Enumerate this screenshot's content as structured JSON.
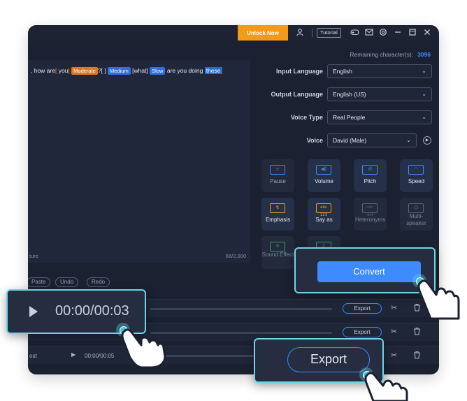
{
  "titlebar": {
    "unlock_label": "Unlock Now",
    "tutorial_label": "Tutorial",
    "icons": [
      "user-icon",
      "gamepad-icon",
      "mail-icon",
      "settings-icon",
      "minimize-icon",
      "maximize-icon",
      "close-icon"
    ]
  },
  "editor": {
    "text_before": ", how are",
    "bracket_open": "[",
    "word_you": " you",
    "bracket_close": "]",
    "tag_moderate": "Moderate",
    "text_q": "?[ ]",
    "tag_medium": "Medium",
    "text_what": "[what]",
    "tag_slow": "Slow",
    "text_doing": "are you doing",
    "highlight": "these",
    "footer_left": "ture",
    "char_count": "66/2,000"
  },
  "edit_buttons": {
    "paste": "Paste",
    "undo": "Undo",
    "redo": "Redo"
  },
  "right_panel": {
    "remaining_label": "Remaining character(s):",
    "remaining_value": "3096",
    "input_language_label": "Input Language",
    "input_language_value": "English",
    "output_language_label": "Output Language",
    "output_language_value": "English (US)",
    "voice_type_label": "Voice Type",
    "voice_type_value": "Real People",
    "voice_label": "Voice",
    "voice_value": "David (Male)"
  },
  "tools": [
    {
      "label": "Pause",
      "icon": "pause-icon"
    },
    {
      "label": "Volume",
      "icon": "volume-icon"
    },
    {
      "label": "Pitch",
      "icon": "pitch-icon"
    },
    {
      "label": "Speed",
      "icon": "speed-icon"
    },
    {
      "label": "Emphasis",
      "icon": "emphasis-icon"
    },
    {
      "label": "Say as",
      "icon": "say-as-icon",
      "icon_text": "abc 123"
    },
    {
      "label": "Heteronyms",
      "icon": "heteronyms-icon",
      "icon_text": "abc def"
    },
    {
      "label": "Multi-speaker",
      "icon": "multi-speaker-icon"
    },
    {
      "label": "Sound Effect",
      "icon": "sound-effect-icon"
    },
    {
      "label": "",
      "icon": "music-icon"
    }
  ],
  "tracks": [
    {
      "export_label": "Export"
    },
    {
      "export_label": "Export"
    },
    {
      "name": "ost",
      "time": "00:00/00:05"
    }
  ],
  "player_callout": {
    "time": "00:00/00:03"
  },
  "convert_callout": {
    "label": "Convert"
  },
  "export_callout": {
    "label": "Export"
  },
  "colors": {
    "accent": "#3d8bff",
    "unlock": "#f39a1b",
    "callout_border": "#6ad7e6",
    "window_bg": "#1b2130"
  }
}
